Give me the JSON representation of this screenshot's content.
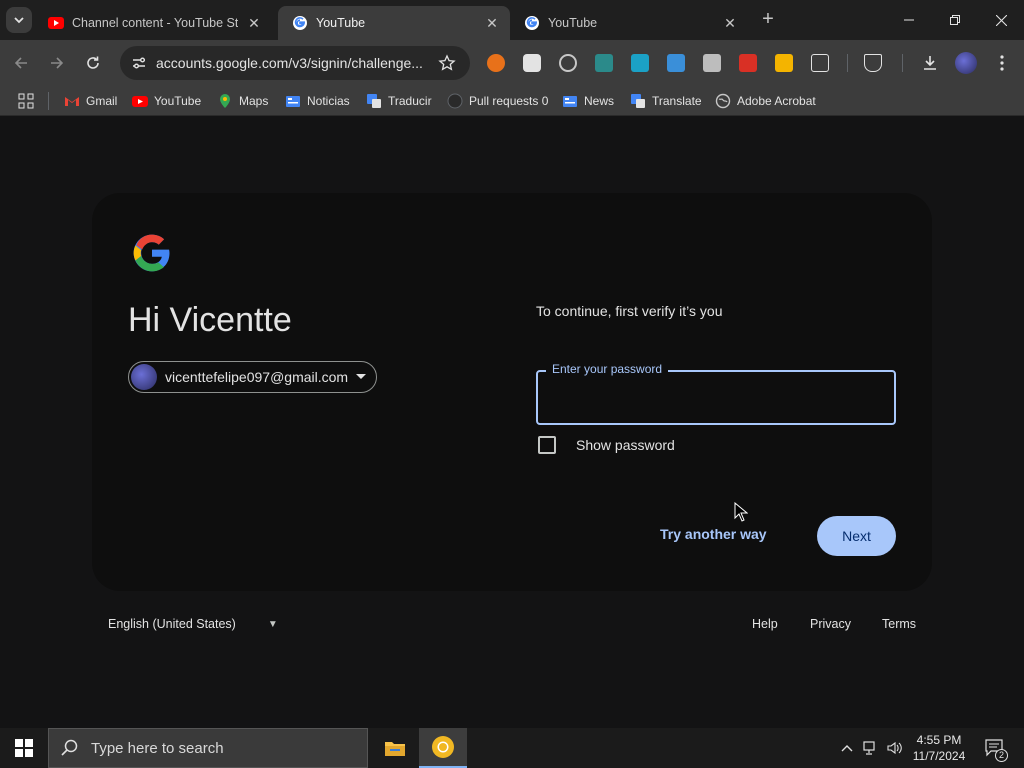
{
  "browser": {
    "tabs": [
      {
        "title": "Channel content - YouTube Stu",
        "favicon": "youtube-icon",
        "active": false
      },
      {
        "title": "YouTube",
        "favicon": "google-icon",
        "active": true
      },
      {
        "title": "YouTube",
        "favicon": "google-icon",
        "active": false
      }
    ],
    "url": "accounts.google.com/v3/signin/challenge...",
    "bookmarks": [
      {
        "label": "Gmail",
        "icon": "gmail-icon"
      },
      {
        "label": "YouTube",
        "icon": "youtube-icon"
      },
      {
        "label": "Maps",
        "icon": "maps-icon"
      },
      {
        "label": "Noticias",
        "icon": "news-icon"
      },
      {
        "label": "Traducir",
        "icon": "translate-icon"
      },
      {
        "label": "Pull requests 0",
        "icon": "github-icon"
      },
      {
        "label": "News",
        "icon": "news-icon"
      },
      {
        "label": "Translate",
        "icon": "translate-icon"
      },
      {
        "label": "Adobe Acrobat",
        "icon": "globe-icon"
      }
    ]
  },
  "signin": {
    "greeting": "Hi Vicentte",
    "email": "vicenttefelipe097@gmail.com",
    "verify_text": "To continue, first verify it’s you",
    "password_label": "Enter your password",
    "password_value": "",
    "show_password_label": "Show password",
    "try_another_label": "Try another way",
    "next_label": "Next"
  },
  "footer": {
    "language": "English (United States)",
    "help": "Help",
    "privacy": "Privacy",
    "terms": "Terms"
  },
  "taskbar": {
    "search_placeholder": "Type here to search",
    "time": "4:55 PM",
    "date": "11/7/2024",
    "notification_count": "2"
  },
  "colors": {
    "accent": "#a8c7fa",
    "page_bg": "#131314",
    "card_bg": "#0e0e0e"
  }
}
